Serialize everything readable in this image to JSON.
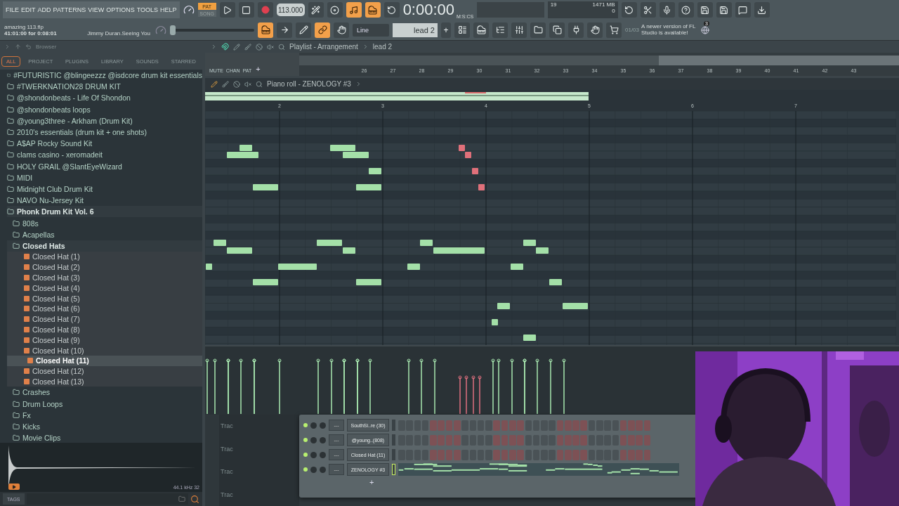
{
  "menu": [
    "FILE",
    "EDIT",
    "ADD",
    "PATTERNS",
    "VIEW",
    "OPTIONS",
    "TOOLS",
    "HELP"
  ],
  "project": {
    "file": "amazing 113.flp",
    "duration": "41:01:00 for 0:08:01",
    "song": "Jimmy Duran.Seeing You"
  },
  "mode": [
    {
      "label": "PAT",
      "selected": true
    },
    {
      "label": "SONG",
      "selected": false
    }
  ],
  "tempo": "113.000",
  "time": {
    "value": "0:00:00",
    "format": "M:S:CS"
  },
  "monitor": {
    "voices": "19",
    "memory": "1471 MB",
    "polyphony": "0"
  },
  "toggles": [
    {
      "on": false
    },
    {
      "on": false
    },
    {
      "on": true
    },
    {
      "on": true
    },
    {
      "on": false
    }
  ],
  "toggles2": [
    {
      "on": true
    },
    {
      "on": false
    },
    {
      "on": false
    },
    {
      "on": true
    },
    {
      "on": false
    }
  ],
  "pitch": {
    "level": 0
  },
  "snap": "Line",
  "pattern": "lead 2",
  "add_pattern": "+",
  "news": {
    "count": "01/03",
    "text": "A newer version of FL Studio is available!",
    "badge": "3"
  },
  "browser": {
    "title": "Browser",
    "tabs": [
      {
        "label": "ALL",
        "selected": true
      },
      {
        "label": "PROJECT",
        "selected": false
      },
      {
        "label": "PLUGINS",
        "selected": false
      },
      {
        "label": "LIBRARY",
        "selected": false
      },
      {
        "label": "SOUNDS",
        "selected": false
      },
      {
        "label": "STARRED",
        "selected": false
      }
    ],
    "tree": [
      {
        "label": "#FUTURISTIC @blingeezzz  @isdcore drum kit essentials",
        "kind": "folder",
        "expanded": false,
        "selected": false
      },
      {
        "label": "#TWERKNATION28 DRUM KIT",
        "kind": "folder",
        "expanded": false,
        "selected": false
      },
      {
        "label": "@shondonbeats - Life Of Shondon",
        "kind": "folder",
        "expanded": false,
        "selected": false
      },
      {
        "label": "@shondonbeats loops",
        "kind": "folder",
        "expanded": false,
        "selected": false
      },
      {
        "label": "@young3three - Arkham (Drum Kit)",
        "kind": "folder",
        "expanded": false,
        "selected": false
      },
      {
        "label": "2010's essentials (drum kit + one shots)",
        "kind": "folder",
        "expanded": false,
        "selected": false
      },
      {
        "label": "A$AP Rocky Sound Kit",
        "kind": "folder",
        "expanded": false,
        "selected": false
      },
      {
        "label": "clams casino - xeromadeit",
        "kind": "folder",
        "expanded": false,
        "selected": false
      },
      {
        "label": "HOLY GRAIL @SlantEyeWizard",
        "kind": "folder",
        "expanded": false,
        "selected": false
      },
      {
        "label": "MIDI",
        "kind": "folder",
        "expanded": false,
        "selected": false
      },
      {
        "label": "Midnight Club Drum Kit",
        "kind": "folder",
        "expanded": false,
        "selected": false
      },
      {
        "label": "NAVO Nu-Jersey Kit",
        "kind": "folder",
        "expanded": false,
        "selected": false
      },
      {
        "label": "Phonk Drum Kit Vol. 6",
        "kind": "folder",
        "expanded": true,
        "selected": false,
        "children": [
          {
            "label": "808s",
            "kind": "folder",
            "expanded": false,
            "selected": false
          },
          {
            "label": "Acapellas",
            "kind": "folder",
            "expanded": false,
            "selected": false
          },
          {
            "label": "Closed Hats",
            "kind": "folder",
            "expanded": true,
            "selected": false,
            "children": [
              {
                "label": "Closed Hat (1)",
                "kind": "file",
                "selected": false
              },
              {
                "label": "Closed Hat (2)",
                "kind": "file",
                "selected": false
              },
              {
                "label": "Closed Hat (3)",
                "kind": "file",
                "selected": false
              },
              {
                "label": "Closed Hat (4)",
                "kind": "file",
                "selected": false
              },
              {
                "label": "Closed Hat (5)",
                "kind": "file",
                "selected": false
              },
              {
                "label": "Closed Hat (6)",
                "kind": "file",
                "selected": false
              },
              {
                "label": "Closed Hat (7)",
                "kind": "file",
                "selected": false
              },
              {
                "label": "Closed Hat (8)",
                "kind": "file",
                "selected": false
              },
              {
                "label": "Closed Hat (9)",
                "kind": "file",
                "selected": false
              },
              {
                "label": "Closed Hat (10)",
                "kind": "file",
                "selected": false
              },
              {
                "label": "Closed Hat (11)",
                "kind": "file",
                "selected": true
              },
              {
                "label": "Closed Hat (12)",
                "kind": "file",
                "selected": false
              },
              {
                "label": "Closed Hat (13)",
                "kind": "file",
                "selected": false
              }
            ]
          },
          {
            "label": "Crashes",
            "kind": "folder",
            "expanded": false,
            "selected": false
          },
          {
            "label": "Drum Loops",
            "kind": "folder",
            "expanded": false,
            "selected": false
          },
          {
            "label": "Fx",
            "kind": "folder",
            "expanded": false,
            "selected": false
          },
          {
            "label": "Kicks",
            "kind": "folder",
            "expanded": false,
            "selected": false
          },
          {
            "label": "Movie Clips",
            "kind": "folder",
            "expanded": false,
            "selected": false
          }
        ]
      }
    ],
    "preview": {
      "info": "44.1 kHz 32"
    },
    "tags": "TAGS"
  },
  "playlist": {
    "title": "Playlist - Arrangement",
    "pattern": "lead 2",
    "mini_buttons": [
      "MUTE",
      "CHAN",
      "PAT"
    ],
    "add": "+",
    "ruler": [
      "26",
      "27",
      "28",
      "29",
      "30",
      "31",
      "32",
      "33",
      "34",
      "35",
      "36",
      "37",
      "38",
      "39",
      "40",
      "41",
      "42",
      "43"
    ],
    "tracks": [
      "Trac",
      "Trac",
      "Trac",
      "Trac"
    ]
  },
  "piano_roll": {
    "title": "Piano roll - ZENOLOGY #3",
    "bars": [
      "2",
      "3",
      "4",
      "5",
      "6",
      "7"
    ]
  },
  "channel_rack": {
    "add": "+",
    "channels": [
      {
        "name": "SouthSi..re (30)",
        "mixer": "---",
        "kind": "steps",
        "on": true,
        "selected": false
      },
      {
        "name": "@young..(808)",
        "mixer": "---",
        "kind": "steps",
        "on": true,
        "selected": false
      },
      {
        "name": "Closed Hat (11)",
        "mixer": "---",
        "kind": "steps",
        "on": true,
        "selected": false
      },
      {
        "name": "ZENOLOGY #3",
        "mixer": "---",
        "kind": "pianoroll",
        "on": true,
        "selected": true
      }
    ]
  }
}
